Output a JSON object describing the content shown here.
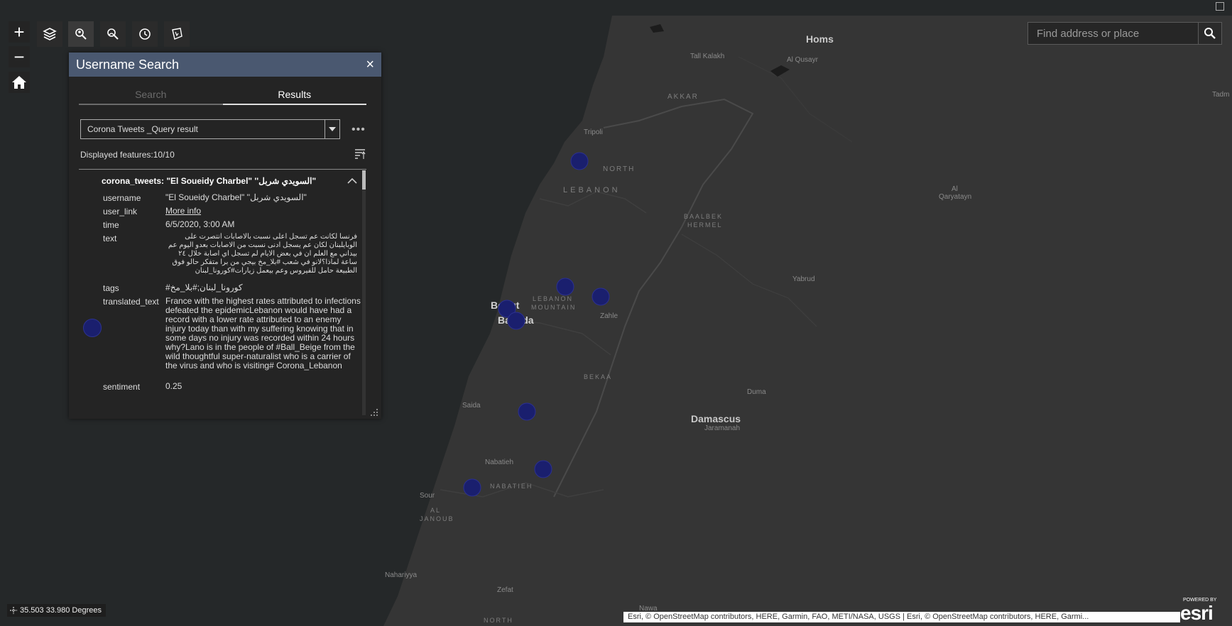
{
  "map": {
    "labels": {
      "homs": "Homs",
      "tall_kalakh": "Tall Kalakh",
      "al_qusayr": "Al Qusayr",
      "akkar": "AKKAR",
      "tadm": "Tadm",
      "tripoli": "Tripoli",
      "north": "NORTH",
      "lebanon": "LEBANON",
      "al_qaryatayn_1": "Al",
      "al_qaryatayn_2": "Qaryatayn",
      "baalbek_1": "BAALBEK",
      "baalbek_2": "HERMEL",
      "yabrud": "Yabrud",
      "beirut": "Beirut",
      "baabda": "Baabda",
      "lebanon_mountain_1": "LEBANON",
      "lebanon_mountain_2": "MOUNTAIN",
      "zahle": "Zahle",
      "bekaa": "BEKAA",
      "duma": "Duma",
      "saida": "Saida",
      "damascus": "Damascus",
      "jaramanah": "Jaramanah",
      "nabatieh_city": "Nabatieh",
      "nabatieh_region": "NABATIEH",
      "sour": "Sour",
      "al_janoub_1": "AL",
      "al_janoub_2": "JANOUB",
      "nahariyya": "Nahariyya",
      "zefat": "Zefat",
      "nawa": "Nawa",
      "north_bottom": "NORTH"
    },
    "marker_color": "#1a1f6e"
  },
  "toolbar": {
    "zoom_in": "+",
    "zoom_out": "−"
  },
  "search": {
    "placeholder": "Find address or place"
  },
  "panel": {
    "title": "Username Search",
    "close": "×",
    "tabs": [
      "Search",
      "Results"
    ],
    "layer_select": "Corona Tweets _Query result",
    "more": "•••",
    "displayed": "Displayed features:10/10",
    "result_title": "corona_tweets: \"El Soueidy Charbel\" ''السويدي شربل\"",
    "fields": {
      "username_key": "username",
      "username_val": "\"El Soueidy Charbel\" ''السويدي شربل\"",
      "user_link_key": "user_link",
      "user_link_val": "More info",
      "time_key": "time",
      "time_val": "6/5/2020, 3:00 AM",
      "text_key": "text",
      "text_val": "فرنسا لكانت عم تسجل اعلى نسبت بالاصابات انتصرت على الوبايلبنان لكان عم يسجل ادنى نسبت من الاصابات بعدو اليوم عم بيداني مع العلم ان في بعض الايام لم تسجل اي اصابة خلال ٢٤ ساعة لماذا؟لانو في شعب #بلا_مخ بيجي من برا متفكر حالو فوق الطبيعة حامل للفيروس وعم بيعمل زيارات#كورونا_لبنان",
      "tags_key": "tags",
      "tags_val": "#كورونا_لبنان;#بلا_مخ",
      "translated_key": "translated_text",
      "translated_val": "France with the highest rates attributed to infections defeated the epidemicLebanon would have had a record with a lower rate attributed to an enemy injury today than with my suffering knowing that in some days no injury was recorded within 24 hours why?Lano is in the people of #Ball_Beige from the wild thoughtful super-naturalist who is a carrier of the virus and who is visiting# Corona_Lebanon",
      "sentiment_key": "sentiment",
      "sentiment_val": "0.25"
    }
  },
  "status": {
    "coords": "35.503 33.980 Degrees",
    "attribution": "Esri, © OpenStreetMap contributors, HERE, Garmin, FAO, METI/NASA, USGS | Esri, © OpenStreetMap contributors, HERE, Garmi...",
    "esri_small": "POWERED BY",
    "esri_word": "esri"
  }
}
